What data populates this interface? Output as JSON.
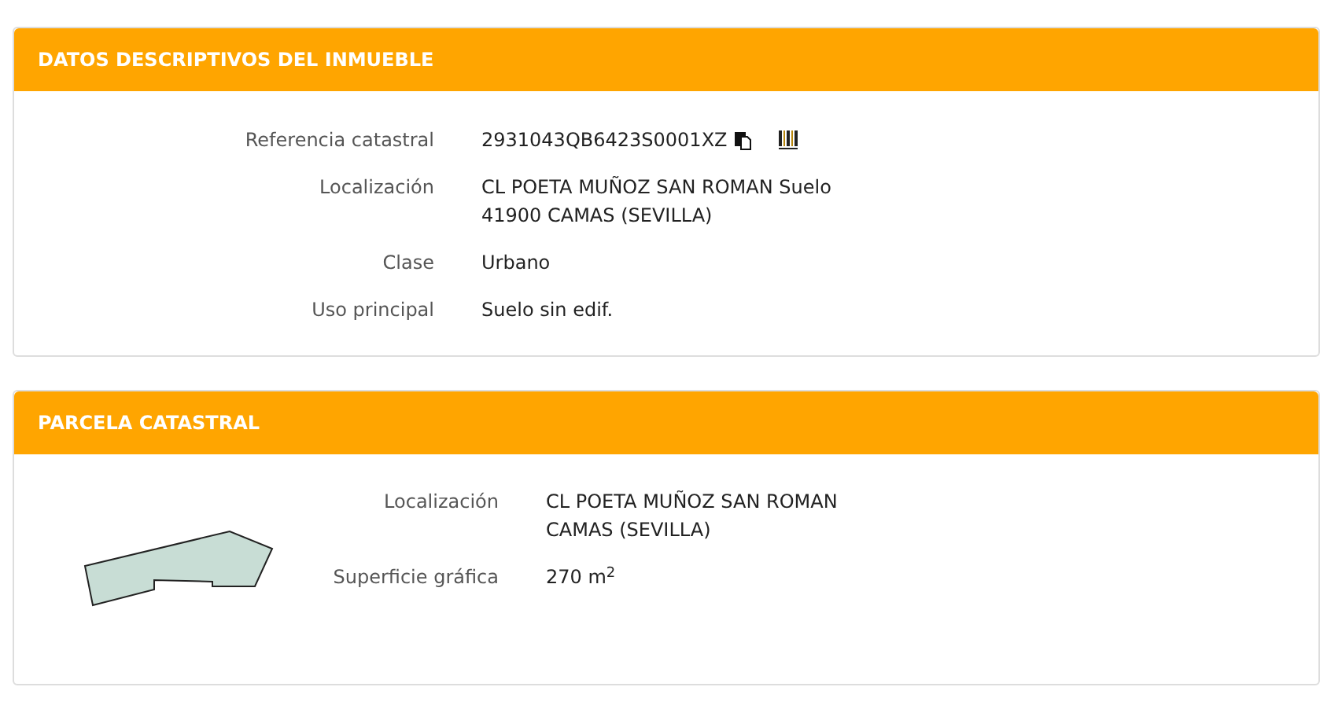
{
  "panels": [
    {
      "title": "DATOS DESCRIPTIVOS DEL INMUEBLE",
      "kind": "fields",
      "rows": [
        {
          "label": "Referencia catastral",
          "lines": [
            "2931043QB6423S0001XZ"
          ],
          "icons": true
        },
        {
          "label": "Localización",
          "lines": [
            "CL POETA MUÑOZ SAN ROMAN Suelo",
            "41900 CAMAS (SEVILLA)"
          ]
        },
        {
          "label": "Clase",
          "lines": [
            "Urbano"
          ]
        },
        {
          "label": "Uso principal",
          "lines": [
            "Suelo sin edif."
          ]
        }
      ]
    },
    {
      "title": "PARCELA CATASTRAL",
      "kind": "parcel",
      "rows": [
        {
          "label": "Localización",
          "lines": [
            "CL POETA MUÑOZ SAN ROMAN",
            "CAMAS (SEVILLA)"
          ]
        },
        {
          "label": "Superficie gráfica",
          "lines": [
            "270 m$^{2}$"
          ]
        }
      ]
    }
  ]
}
